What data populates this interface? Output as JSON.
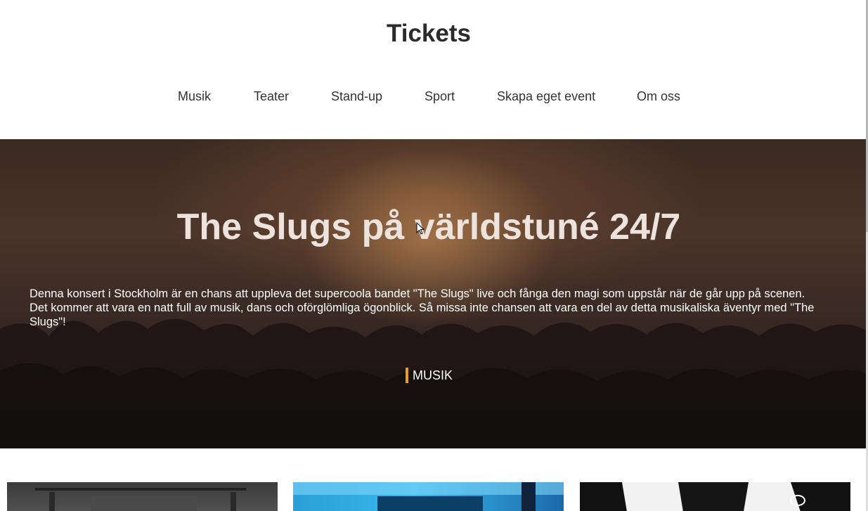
{
  "site": {
    "title": "Tickets"
  },
  "nav": {
    "items": [
      {
        "label": "Musik"
      },
      {
        "label": "Teater"
      },
      {
        "label": "Stand-up"
      },
      {
        "label": "Sport"
      },
      {
        "label": "Skapa eget event"
      },
      {
        "label": "Om oss"
      }
    ]
  },
  "hero": {
    "title": "The Slugs på världstuné 24/7",
    "description": "Denna konsert i Stockholm är en chans att uppleva det supercoola bandet \"The Slugs\" live och fånga den magi som uppstår när de går upp på scenen. Det kommer att vara en natt full av musik, dans och oförglömliga ögonblick. Så missa inte chansen att vara en del av detta musikaliska äventyr med \"The Slugs\"!",
    "category": "MUSIK"
  },
  "colors": {
    "accent": "#e8a020",
    "text_dark": "#2b2b2b",
    "hero_text": "#ffffff"
  }
}
